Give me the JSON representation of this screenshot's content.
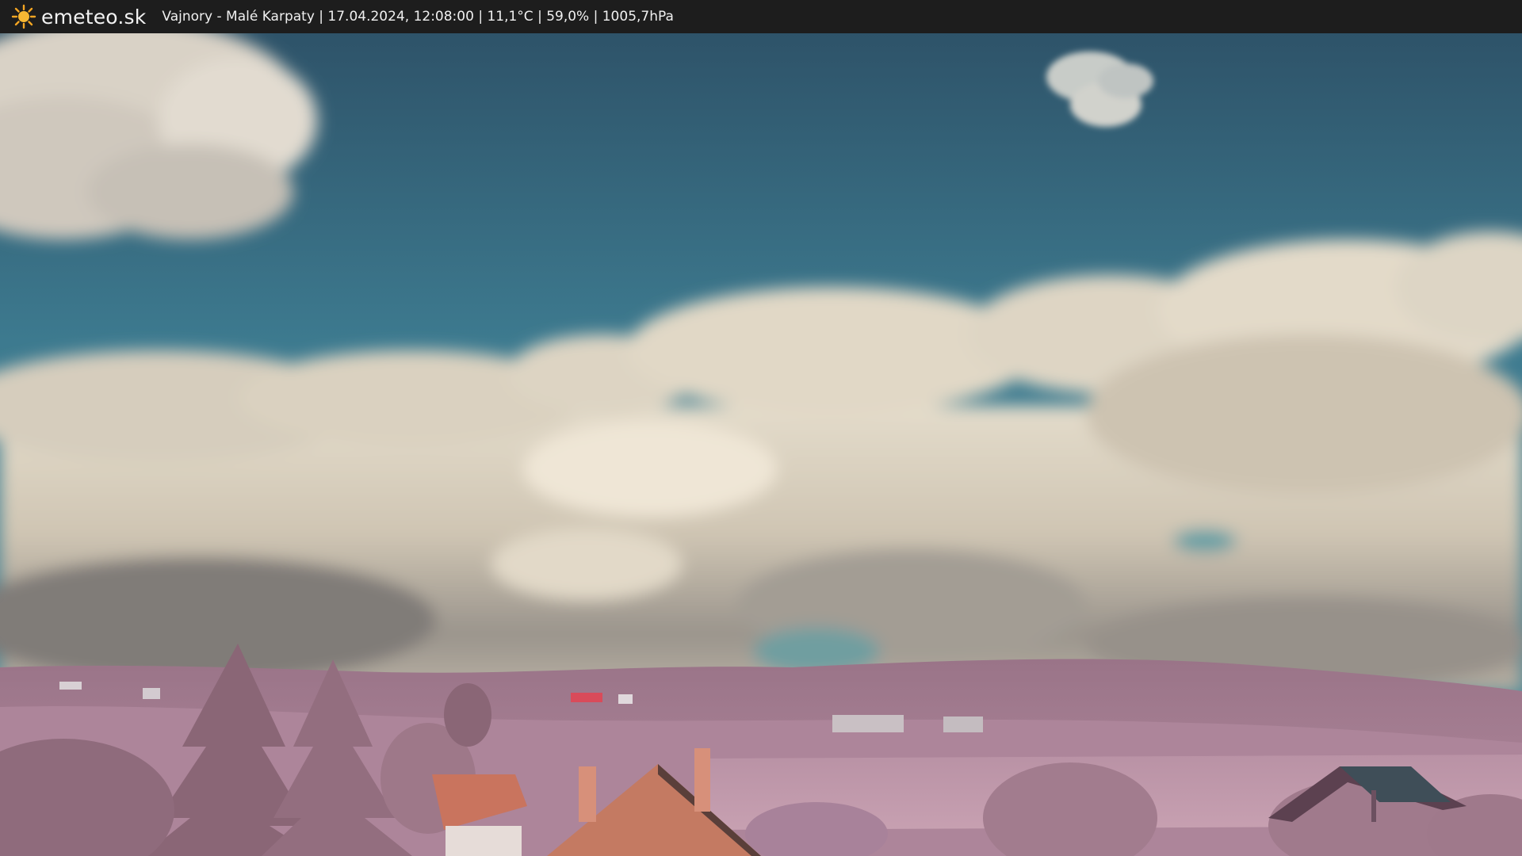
{
  "header": {
    "brand": "emeteo.sk",
    "logo_icon": "sun-icon",
    "caption": "Vajnory - Malé Karpaty | 17.04.2024, 12:08:00 | 11,1°C | 59,0% | 1005,7hPa"
  },
  "colors": {
    "bar": "#1d1d1d",
    "sun": "#f5a623",
    "sky_top": "#2f566c",
    "sky_bottom": "#3f7e92",
    "cloud": "#dcd3c2",
    "hills": "#a67e92",
    "roof": "#c9745e"
  }
}
